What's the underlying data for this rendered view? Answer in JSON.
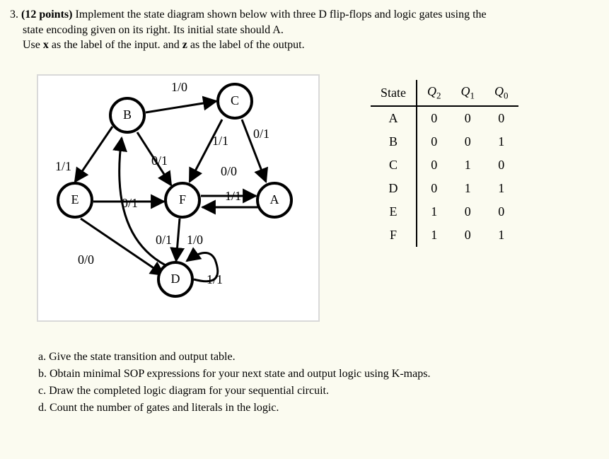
{
  "question": {
    "number": "3.",
    "points": "(12 points)",
    "body1": "Implement the state diagram shown below with three D flip-flops and logic gates using the",
    "body2": "state encoding given on its right. Its initial state should A.",
    "body3_pre": "Use ",
    "body3_x": "x",
    "body3_mid": " as the label of the input. and ",
    "body3_z": "z",
    "body3_post": " as the label of the output."
  },
  "diagram": {
    "nodes": {
      "A": "A",
      "B": "B",
      "C": "C",
      "D": "D",
      "E": "E",
      "F": "F"
    },
    "edges": {
      "BC": "1/0",
      "CA0": "0/1",
      "CF": "1/1",
      "BF": "0/1",
      "FA0": "0/0",
      "AF": "1/1",
      "BE": "1/1",
      "EF": "0/1",
      "ED": "0/0",
      "FD": "0/1",
      "DB": "1/0",
      "DD": "1/1"
    }
  },
  "table": {
    "headers": {
      "state": "State",
      "q2": "Q",
      "q2s": "2",
      "q1": "Q",
      "q1s": "1",
      "q0": "Q",
      "q0s": "0"
    },
    "rows": [
      {
        "state": "A",
        "q2": "0",
        "q1": "0",
        "q0": "0"
      },
      {
        "state": "B",
        "q2": "0",
        "q1": "0",
        "q0": "1"
      },
      {
        "state": "C",
        "q2": "0",
        "q1": "1",
        "q0": "0"
      },
      {
        "state": "D",
        "q2": "0",
        "q1": "1",
        "q0": "1"
      },
      {
        "state": "E",
        "q2": "1",
        "q1": "0",
        "q0": "0"
      },
      {
        "state": "F",
        "q2": "1",
        "q1": "0",
        "q0": "1"
      }
    ]
  },
  "subq": {
    "a": "a. Give the state transition and output table.",
    "b": "b. Obtain minimal SOP expressions for your next state and output logic using K-maps.",
    "c": "c. Draw the completed logic diagram for your sequential circuit.",
    "d": "d. Count the number of gates and literals in the logic."
  }
}
